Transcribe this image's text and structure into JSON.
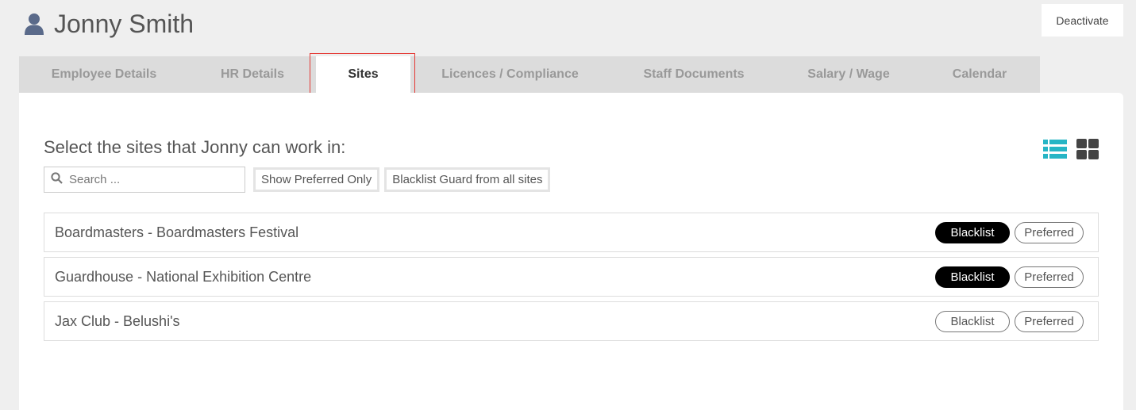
{
  "header": {
    "title": "Jonny Smith",
    "icon": "user-icon",
    "deactivate_label": "Deactivate"
  },
  "tabs": [
    {
      "label": "Employee Details",
      "active": false
    },
    {
      "label": "HR Details",
      "active": false
    },
    {
      "label": "Sites",
      "active": true
    },
    {
      "label": "Licences / Compliance",
      "active": false
    },
    {
      "label": "Staff Documents",
      "active": false
    },
    {
      "label": "Salary / Wage",
      "active": false
    },
    {
      "label": "Calendar",
      "active": false
    }
  ],
  "main": {
    "subtitle": "Select the sites that Jonny can work in:",
    "search": {
      "placeholder": "Search ...",
      "value": ""
    },
    "show_preferred_label": "Show Preferred Only",
    "blacklist_all_label": "Blacklist Guard from all sites",
    "view_icons": [
      "list-view-icon",
      "grid-view-icon"
    ],
    "sites": [
      {
        "name": "Boardmasters - Boardmasters Festival",
        "blacklist_label": "Blacklist",
        "blacklisted": true,
        "preferred_label": "Preferred",
        "preferred": false
      },
      {
        "name": "Guardhouse - National Exhibition Centre",
        "blacklist_label": "Blacklist",
        "blacklisted": true,
        "preferred_label": "Preferred",
        "preferred": false
      },
      {
        "name": "Jax Club - Belushi's",
        "blacklist_label": "Blacklist",
        "blacklisted": false,
        "preferred_label": "Preferred",
        "preferred": false
      }
    ]
  },
  "colors": {
    "accent": "#26b5c5",
    "active_pill": "#000000",
    "highlight": "#e53935"
  }
}
